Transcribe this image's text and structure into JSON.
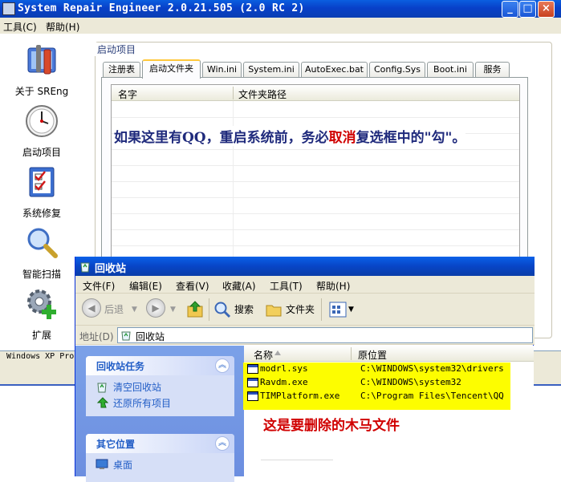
{
  "sreng": {
    "title": "System Repair Engineer 2.0.21.505 (2.0 RC 2)",
    "menu": [
      "工具(C)",
      "帮助(H)"
    ],
    "sidebar": [
      {
        "label": "关于 SREng",
        "icon": "about-icon"
      },
      {
        "label": "启动项目",
        "icon": "clock-icon"
      },
      {
        "label": "系统修复",
        "icon": "checklist-icon"
      },
      {
        "label": "智能扫描",
        "icon": "magnifier-icon"
      },
      {
        "label": "扩展",
        "icon": "gear-plus-icon"
      }
    ],
    "group_label": "启动项目",
    "tabs": [
      "注册表",
      "启动文件夹",
      "Win.ini",
      "System.ini",
      "AutoExec.bat",
      "Config.Sys",
      "Boot.ini",
      "服务"
    ],
    "active_tab": "启动文件夹",
    "columns": [
      "名字",
      "文件夹路径"
    ],
    "status_text": "Windows XP Pro"
  },
  "note_top": {
    "before": "如果这里有QQ，重启系统前，务必",
    "highlight": "取消",
    "after": "复选框中的\"勾\"。"
  },
  "recycle_bin": {
    "title": "回收站",
    "menu": [
      "文件(F)",
      "编辑(E)",
      "查看(V)",
      "收藏(A)",
      "工具(T)",
      "帮助(H)"
    ],
    "toolbar": {
      "back": "后退",
      "search": "搜索",
      "folders": "文件夹"
    },
    "address_label": "地址(D)",
    "address_value": "回收站",
    "tasks": {
      "title": "回收站任务",
      "links": [
        "清空回收站",
        "还原所有项目"
      ]
    },
    "other_places": {
      "title": "其它位置",
      "links": [
        "桌面"
      ]
    },
    "columns": [
      "名称",
      "原位置"
    ],
    "files": [
      {
        "name": "modrl.sys",
        "location": "C:\\WINDOWS\\system32\\drivers"
      },
      {
        "name": "Ravdm.exe",
        "location": "C:\\WINDOWS\\system32"
      },
      {
        "name": "TIMPlatform.exe",
        "location": "C:\\Program Files\\Tencent\\QQ"
      }
    ]
  },
  "note_bottom": "这是要删除的木马文件",
  "colors": {
    "highlight_yellow": "#fdfd00",
    "note_red": "#d00000",
    "note_blue": "#1f2a7c",
    "xp_title_blue": "#0840c8"
  }
}
